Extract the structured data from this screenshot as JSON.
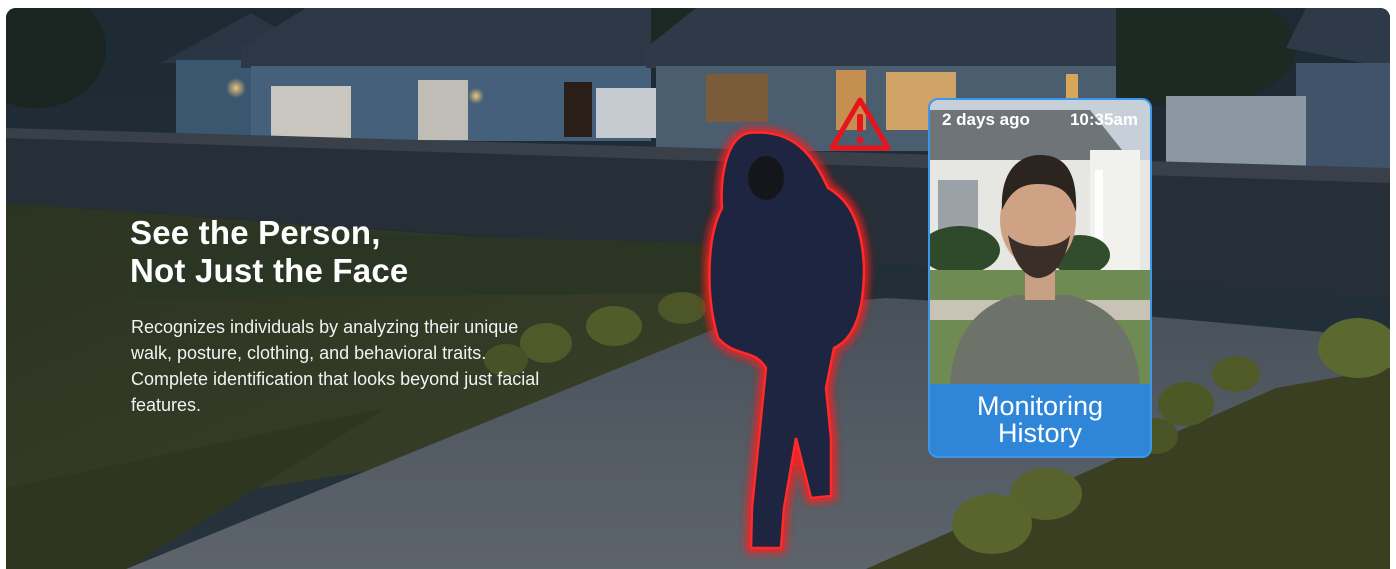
{
  "hero": {
    "title_line1": "See the Person,",
    "title_line2": "Not Just the Face",
    "description": "Recognizes individuals by analyzing their unique walk, posture, clothing, and behavioral traits. Complete identification that looks beyond just facial features."
  },
  "history_card": {
    "date": "2 days ago",
    "time": "10:35am",
    "label_line1": "Monitoring",
    "label_line2": "History"
  },
  "icons": {
    "alert": "warning-triangle-icon"
  },
  "colors": {
    "alert_red": "#e8141c",
    "card_blue": "#2f86d8",
    "text_white": "#ffffff"
  }
}
